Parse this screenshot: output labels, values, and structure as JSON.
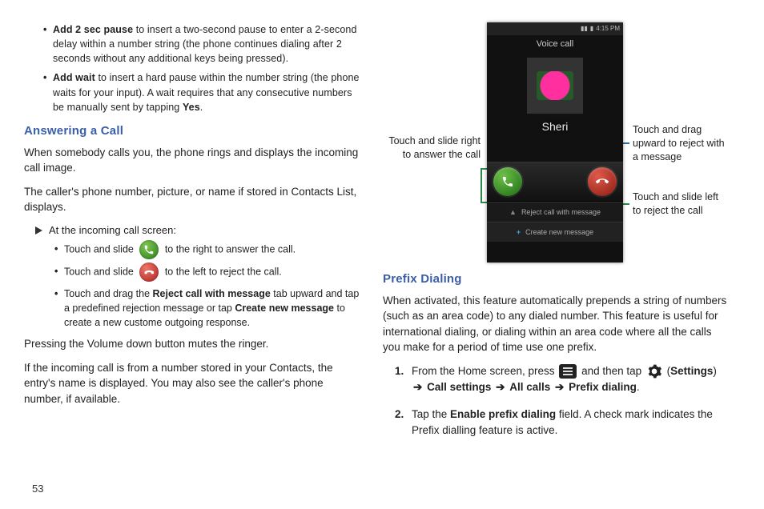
{
  "left": {
    "bullets_top": [
      {
        "lead": "Add 2 sec pause",
        "rest": " to insert a two-second pause to enter a 2-second delay within a number string (the phone continues dialing after 2 seconds without any additional keys being pressed)."
      },
      {
        "lead": "Add wait",
        "rest": " to insert a hard pause within the number string (the phone waits for your input). A wait requires that any consecutive numbers be manually sent by tapping ",
        "tail_bold": "Yes",
        "tail_end": "."
      }
    ],
    "h_answering": "Answering a Call",
    "p1": "When somebody calls you, the phone rings and displays the incoming call image.",
    "p2": "The caller's phone number, picture, or name if stored in Contacts List, displays.",
    "arrow": "At the incoming call screen:",
    "sub": [
      {
        "pre": "Touch and slide ",
        "icon": "green",
        "post": " to the right to answer the call."
      },
      {
        "pre": "Touch and slide ",
        "icon": "red",
        "post": " to the left to reject the call."
      },
      {
        "pre": "Touch and drag the ",
        "b1": "Reject call with message",
        "mid": " tab upward and tap a predefined rejection message or tap ",
        "b2": "Create new message",
        "post2": " to create a new custome outgoing response."
      }
    ],
    "p3": "Pressing the Volume down button mutes the ringer.",
    "p4": "If the incoming call is from a number stored in your Contacts, the entry's name is displayed. You may also see the caller's phone number, if available."
  },
  "right": {
    "figure": {
      "status_time": "4:15 PM",
      "voice_call": "Voice call",
      "caller": "Sheri",
      "reject_bar": "Reject call with message",
      "create_bar": "Create new message",
      "callout_left": "Touch and slide right to answer the call",
      "callout_r1": "Touch and drag upward to reject with a message",
      "callout_r2": "Touch and slide left to reject the call"
    },
    "h_prefix": "Prefix Dialing",
    "p_prefix": "When activated, this feature automatically prepends a string of numbers (such as an area code) to any dialed number. This feature is useful for international dialing, or dialing within an area code where all the calls you make for a period of time use one prefix.",
    "steps": {
      "s1_a": "From the Home screen, press ",
      "s1_b": " and then tap ",
      "s1_c": "Settings",
      "s1_d": "Call settings",
      "s1_e": "All calls",
      "s1_f": "Prefix dialing",
      "s2_a": "Tap the ",
      "s2_b": "Enable prefix dialing",
      "s2_c": " field. A check mark indicates the Prefix dialling feature is active."
    }
  },
  "page_number": "53"
}
